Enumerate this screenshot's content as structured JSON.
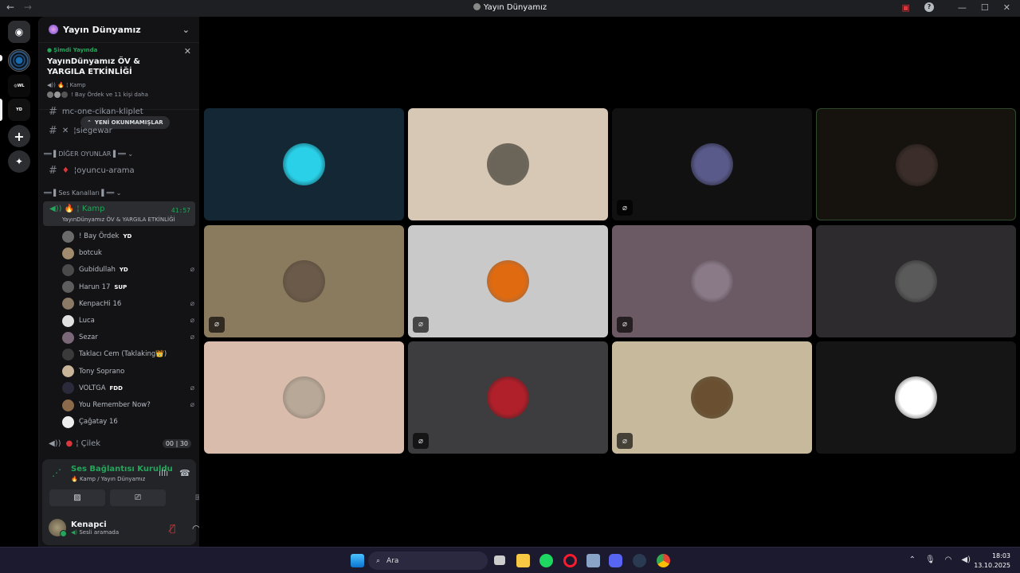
{
  "window": {
    "title": "Yayın Dünyamız",
    "back": "←",
    "forward": "→",
    "help": "?",
    "min": "—",
    "max": "☐",
    "close": "✕"
  },
  "server": {
    "name": "Yayın Dünyamız"
  },
  "live_banner": {
    "tag": "Şimdi Yayında",
    "event": "YayınDünyamız ÖV & YARGILA ETKİNLİĞİ",
    "channel": "Kamp",
    "participants": "! Bay Ördek ve 11 kişi daha"
  },
  "unread_pill": "YENİ OKUNMAMIŞLAR",
  "channels": {
    "partial_top": "mc-one-cikan-kliplet",
    "siegewar": "siegewar",
    "category_games": "DİĞER OYUNLAR",
    "oyuncu": "oyuncu-arama",
    "category_voice": "Ses Kanalları"
  },
  "active_voice": {
    "name": "Kamp",
    "timer": "41:57",
    "subtitle": "YayınDünyamız ÖV & YARGILA ETKİNLİĞİ"
  },
  "members": [
    {
      "name": "! Bay Ördek",
      "badge": "YD",
      "muted": false,
      "color": "#6b6b6b"
    },
    {
      "name": "botcuk",
      "badge": "",
      "muted": false,
      "color": "#a08b6e"
    },
    {
      "name": "Gubidullah",
      "badge": "YD",
      "muted": true,
      "color": "#4a4a4a"
    },
    {
      "name": "Harun 17",
      "badge": "SUP",
      "muted": false,
      "color": "#5d5d5d"
    },
    {
      "name": "KenpacHi 16",
      "badge": "",
      "muted": true,
      "color": "#8a7a66"
    },
    {
      "name": "Luca",
      "badge": "",
      "muted": true,
      "color": "#e0e0e0"
    },
    {
      "name": "Sezar",
      "badge": "",
      "muted": true,
      "color": "#7a6878"
    },
    {
      "name": "Taklacı Cem (Taklaking👑)",
      "badge": "",
      "muted": false,
      "color": "#3a3a3a"
    },
    {
      "name": "Tony Soprano",
      "badge": "",
      "muted": false,
      "color": "#c9b59a"
    },
    {
      "name": "VOLTGA",
      "badge": "FDD",
      "muted": true,
      "color": "#2a2a3a"
    },
    {
      "name": "You Remember Now?",
      "badge": "",
      "muted": true,
      "color": "#8a6a4a"
    },
    {
      "name": "Çağatay 16",
      "badge": "",
      "muted": false,
      "color": "#eeeeee"
    }
  ],
  "cilek": {
    "name": "Çilek",
    "count_a": "00",
    "count_b": "30"
  },
  "voice_panel": {
    "status": "Ses Bağlantısı Kuruldu",
    "location": "Kamp / Yayın Dünyamız"
  },
  "user": {
    "name": "Kenapci",
    "status": "Sesli aramada"
  },
  "tiles": [
    {
      "bg": "#142734",
      "avatar": "#2ad0e8",
      "muted": false,
      "outlined": false
    },
    {
      "bg": "#d6c8b4",
      "avatar": "#6b6458",
      "muted": false,
      "outlined": false
    },
    {
      "bg": "#111111",
      "avatar": "#5a5a8a",
      "muted": true,
      "outlined": false
    },
    {
      "bg": "#16130f",
      "avatar": "#3b2e2a",
      "muted": false,
      "outlined": true
    },
    {
      "bg": "#8a7a5e",
      "avatar": "#6b5a4a",
      "muted": true,
      "outlined": false
    },
    {
      "bg": "#c9c9c9",
      "avatar": "#e06a10",
      "muted": true,
      "outlined": false
    },
    {
      "bg": "#6b5963",
      "avatar": "#8a7a88",
      "muted": true,
      "outlined": false
    },
    {
      "bg": "#2e2b2f",
      "avatar": "#5a5a5a",
      "muted": false,
      "outlined": false
    },
    {
      "bg": "#d9bcac",
      "avatar": "#b8a898",
      "muted": false,
      "outlined": false
    },
    {
      "bg": "#3d3d3f",
      "avatar": "#b0202a",
      "muted": true,
      "outlined": false
    },
    {
      "bg": "#c7b99c",
      "avatar": "#6a5030",
      "muted": true,
      "outlined": false
    },
    {
      "bg": "#151515",
      "avatar": "#ffffff",
      "muted": false,
      "outlined": false
    }
  ],
  "taskbar": {
    "search": "Ara",
    "time": "18:03",
    "date": "13.10.2025"
  }
}
